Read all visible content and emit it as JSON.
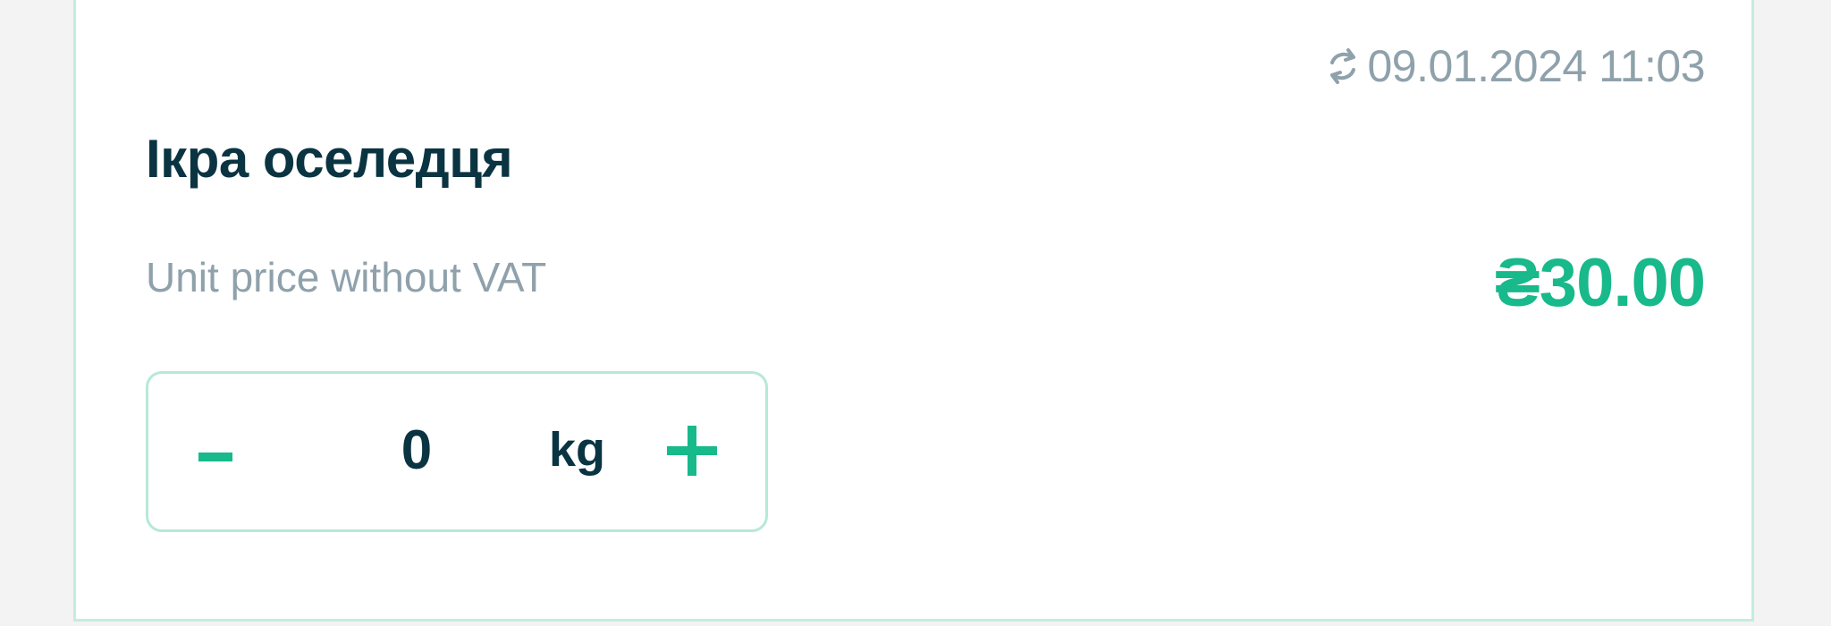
{
  "product": {
    "updated_at": "09.01.2024 11:03",
    "updated_icon": "refresh-icon",
    "name": "Ікра оселедця",
    "price_label": "Unit price without VAT",
    "price": "₴30.00"
  },
  "stepper": {
    "minus_icon": "minus-icon",
    "quantity": "0",
    "unit": "kg",
    "plus_icon": "plus-icon"
  },
  "colors": {
    "accent": "#18b98a",
    "title": "#0a3442",
    "muted": "#8fa1ab",
    "border": "#c4ece1"
  }
}
